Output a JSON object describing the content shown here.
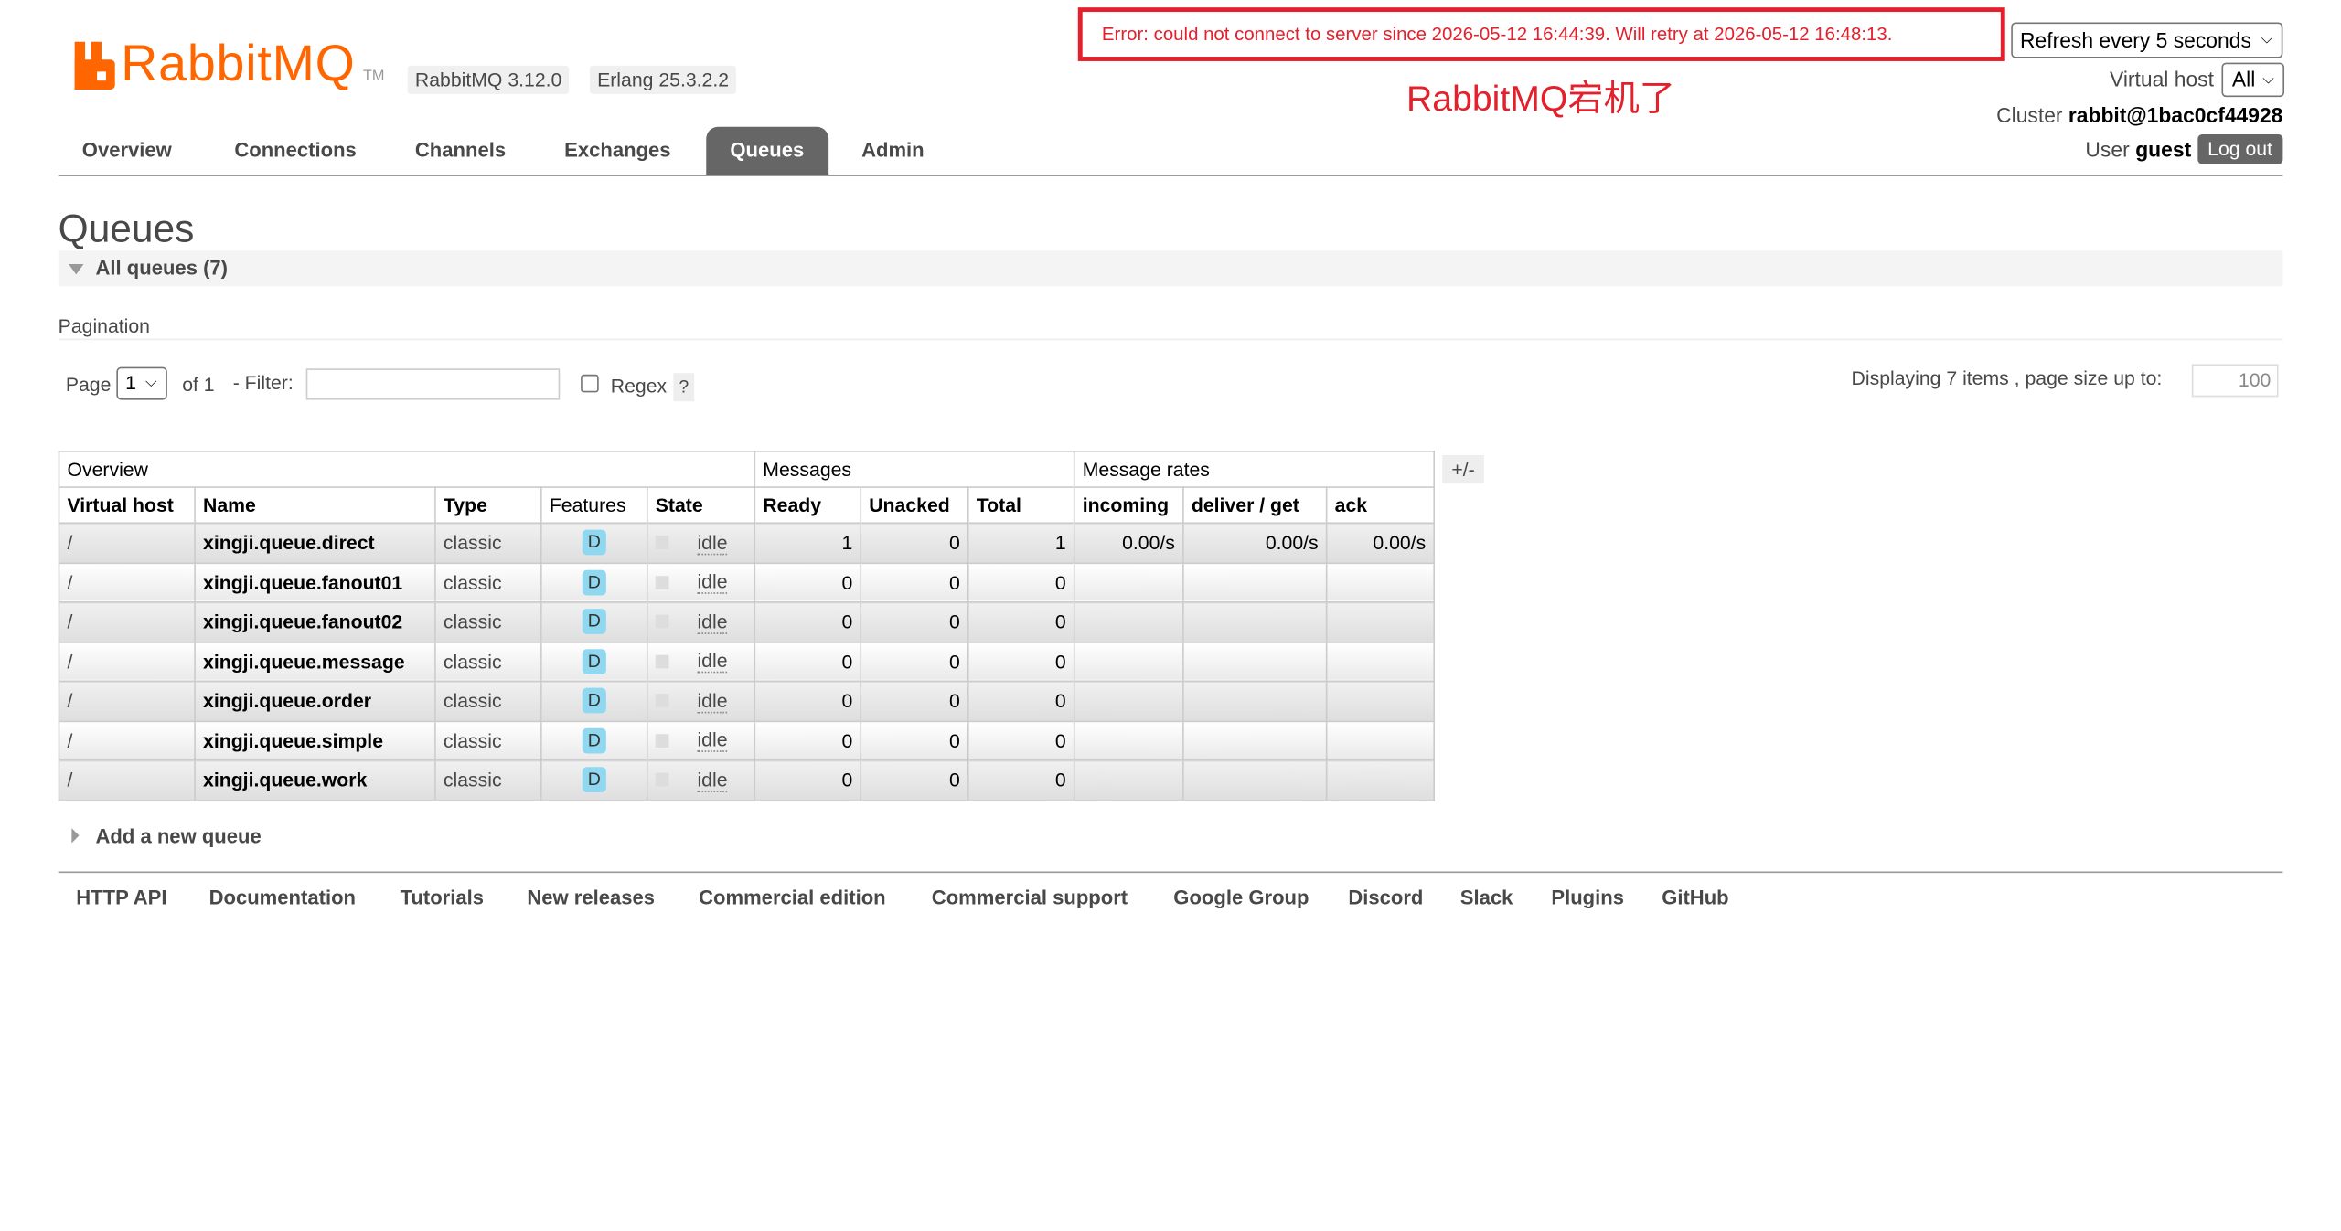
{
  "header": {
    "logo_text": "RabbitMQ",
    "logo_tm": "TM",
    "rabbitmq_version": "RabbitMQ 3.12.0",
    "erlang_version": "Erlang 25.3.2.2",
    "error": "Error: could not connect to server since 2026-05-12 16:44:39. Will retry at 2026-05-12 16:48:13.",
    "annotation": "RabbitMQ宕机了",
    "refresh_select": "Refresh every 5 seconds",
    "virtual_host_label": "Virtual host",
    "virtual_host_value": "All",
    "cluster_label": "Cluster",
    "cluster_value": "rabbit@1bac0cf44928",
    "user_label": "User",
    "user_value": "guest",
    "logout_label": "Log out"
  },
  "nav": {
    "tabs": [
      "Overview",
      "Connections",
      "Channels",
      "Exchanges",
      "Queues",
      "Admin"
    ],
    "active": "Queues"
  },
  "page": {
    "title": "Queues",
    "section_title": "All queues (7)",
    "pagination_label": "Pagination",
    "page_label": "Page",
    "page_value": "1",
    "of_label": "of 1",
    "filter_label": "- Filter:",
    "filter_value": "",
    "regex_label": "Regex",
    "help": "?",
    "displaying": "Displaying 7 items , page size up to:",
    "page_size": "100",
    "columns_toggle": "+/-",
    "add_queue": "Add a new queue"
  },
  "table": {
    "groups": [
      "Overview",
      "Messages",
      "Message rates"
    ],
    "columns": [
      "Virtual host",
      "Name",
      "Type",
      "Features",
      "State",
      "Ready",
      "Unacked",
      "Total",
      "incoming",
      "deliver / get",
      "ack"
    ],
    "rows": [
      {
        "vhost": "/",
        "name": "xingji.queue.direct",
        "type": "classic",
        "feature": "D",
        "state": "idle",
        "ready": "1",
        "unacked": "0",
        "total": "1",
        "incoming": "0.00/s",
        "deliver": "0.00/s",
        "ack": "0.00/s"
      },
      {
        "vhost": "/",
        "name": "xingji.queue.fanout01",
        "type": "classic",
        "feature": "D",
        "state": "idle",
        "ready": "0",
        "unacked": "0",
        "total": "0",
        "incoming": "",
        "deliver": "",
        "ack": ""
      },
      {
        "vhost": "/",
        "name": "xingji.queue.fanout02",
        "type": "classic",
        "feature": "D",
        "state": "idle",
        "ready": "0",
        "unacked": "0",
        "total": "0",
        "incoming": "",
        "deliver": "",
        "ack": ""
      },
      {
        "vhost": "/",
        "name": "xingji.queue.message",
        "type": "classic",
        "feature": "D",
        "state": "idle",
        "ready": "0",
        "unacked": "0",
        "total": "0",
        "incoming": "",
        "deliver": "",
        "ack": ""
      },
      {
        "vhost": "/",
        "name": "xingji.queue.order",
        "type": "classic",
        "feature": "D",
        "state": "idle",
        "ready": "0",
        "unacked": "0",
        "total": "0",
        "incoming": "",
        "deliver": "",
        "ack": ""
      },
      {
        "vhost": "/",
        "name": "xingji.queue.simple",
        "type": "classic",
        "feature": "D",
        "state": "idle",
        "ready": "0",
        "unacked": "0",
        "total": "0",
        "incoming": "",
        "deliver": "",
        "ack": ""
      },
      {
        "vhost": "/",
        "name": "xingji.queue.work",
        "type": "classic",
        "feature": "D",
        "state": "idle",
        "ready": "0",
        "unacked": "0",
        "total": "0",
        "incoming": "",
        "deliver": "",
        "ack": ""
      }
    ]
  },
  "footer": {
    "links": [
      "HTTP API",
      "Documentation",
      "Tutorials",
      "New releases",
      "Commercial edition",
      "Commercial support",
      "Google Group",
      "Discord",
      "Slack",
      "Plugins",
      "GitHub"
    ]
  },
  "colors": {
    "brand": "#ff6600",
    "error": "#e3202b",
    "nav_active": "#666666",
    "durable_badge": "#8fd8f0"
  }
}
